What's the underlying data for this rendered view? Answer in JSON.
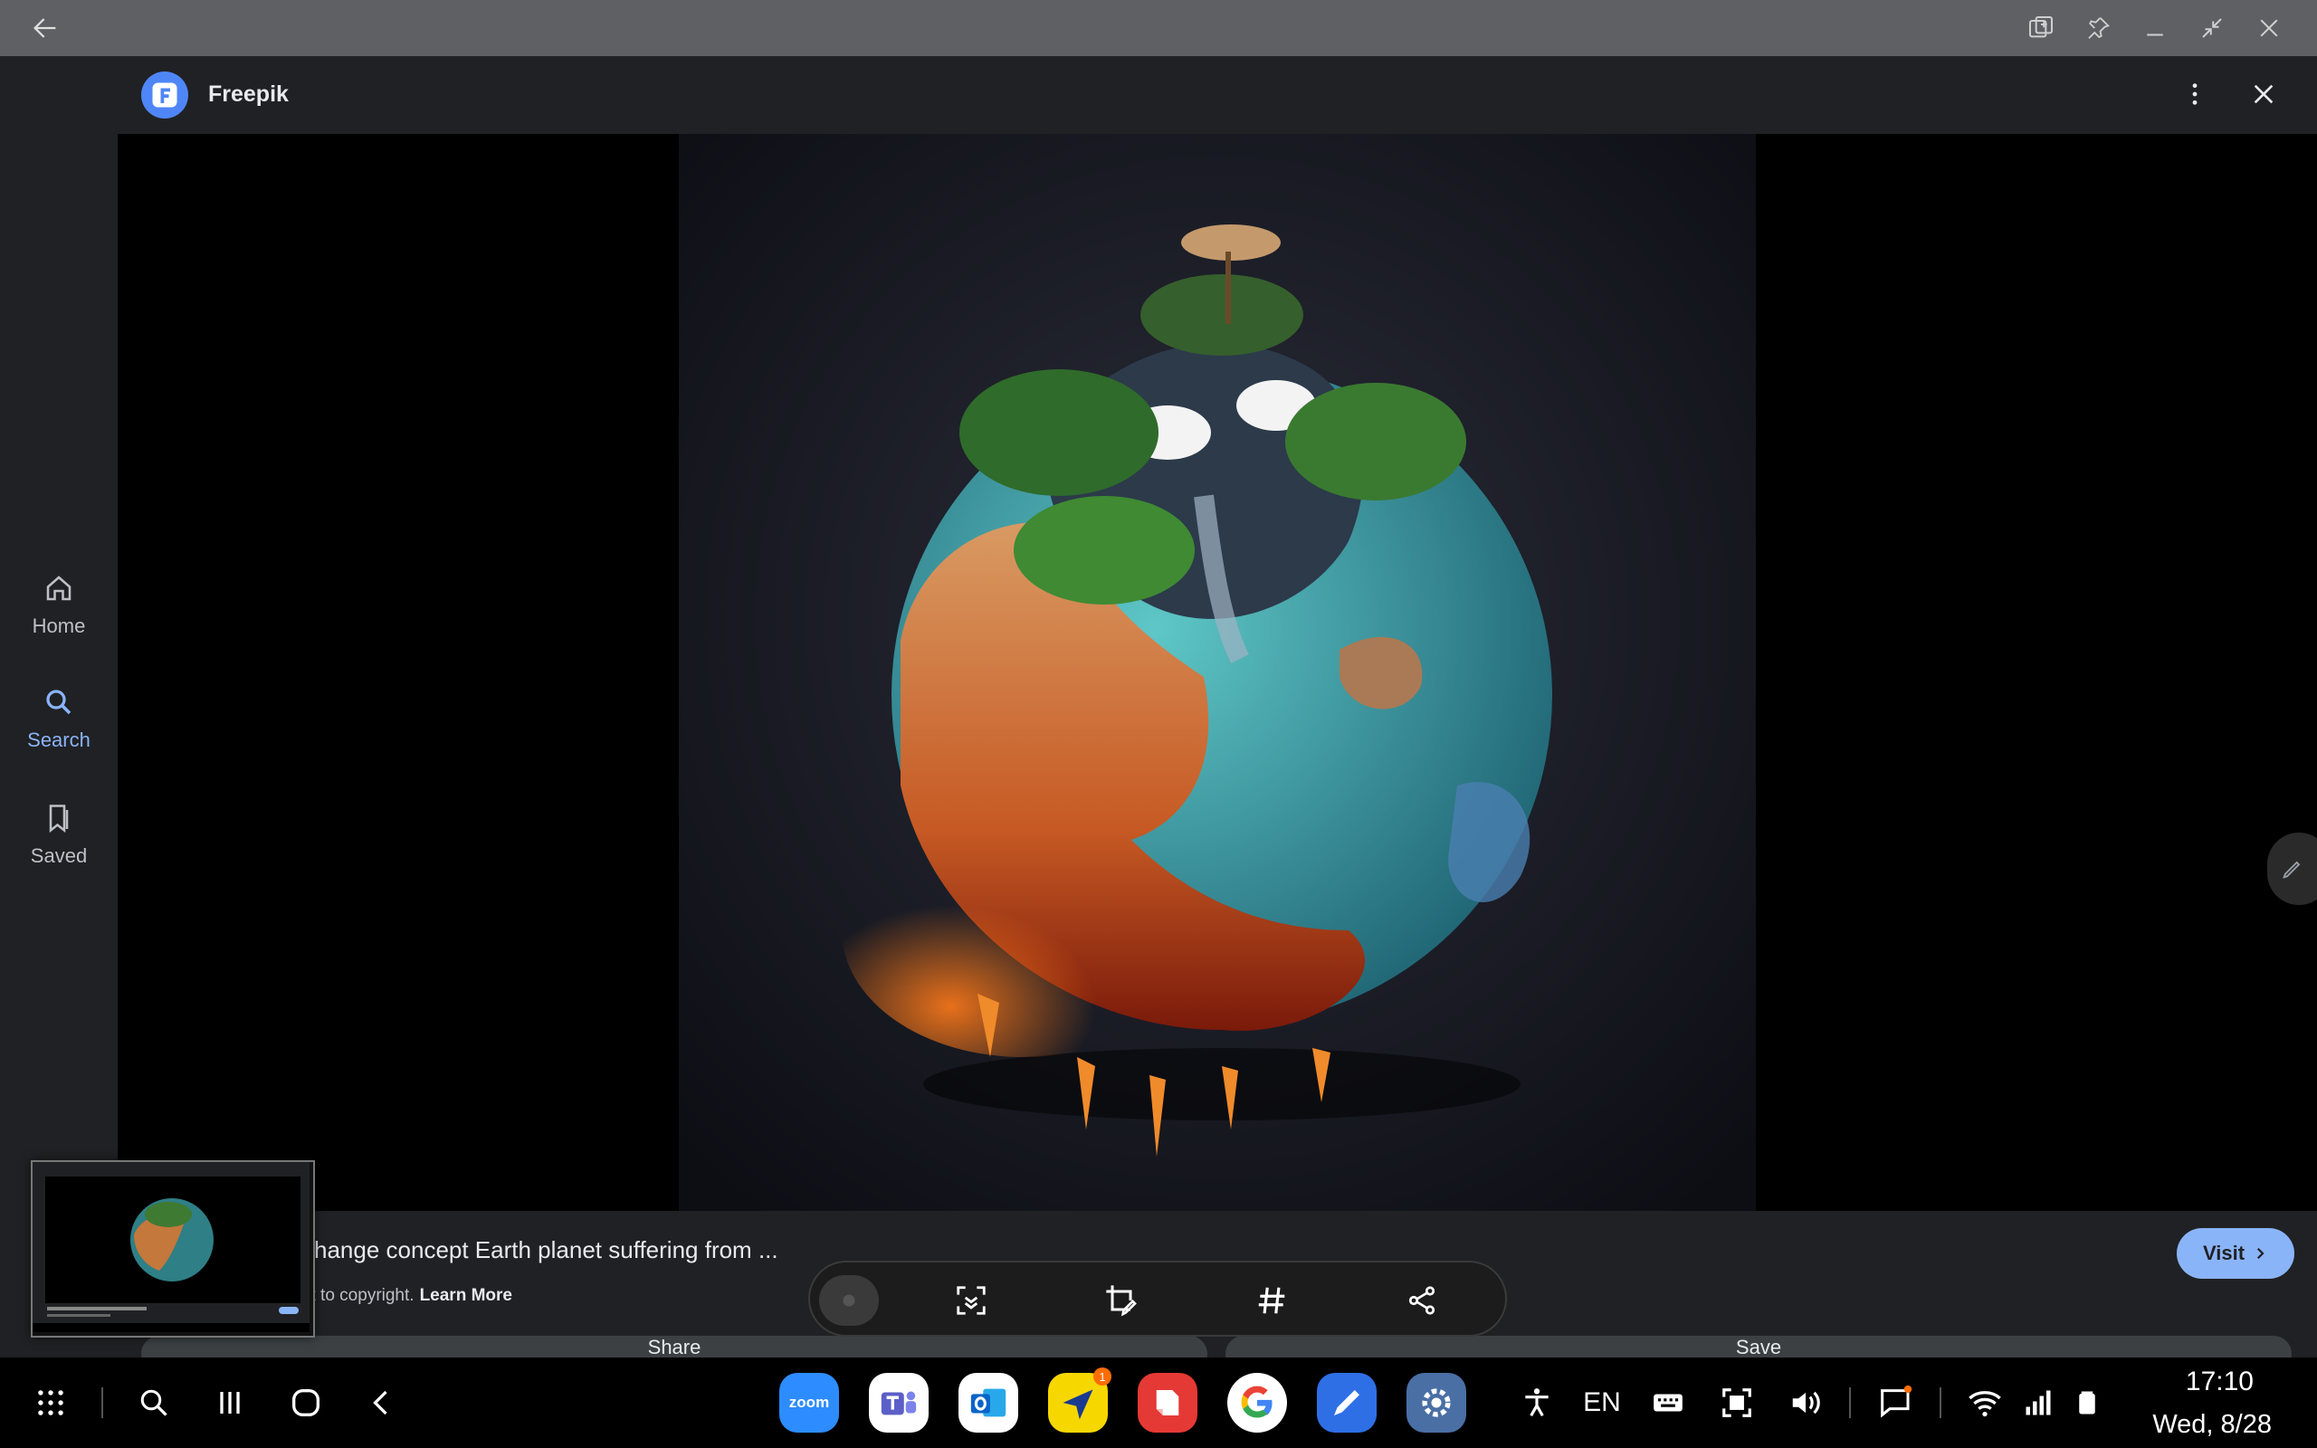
{
  "app": {
    "title": "Freepik"
  },
  "sidebar": {
    "items": [
      {
        "label": "Home",
        "icon": "home-icon"
      },
      {
        "label": "Search",
        "icon": "search-icon",
        "active": true
      },
      {
        "label": "Saved",
        "icon": "bookmark-icon"
      }
    ]
  },
  "result": {
    "caption": "change concept Earth planet suffering from ...",
    "copyright_text": "ct to copyright.",
    "learn_more": "Learn More",
    "visit_label": "Visit",
    "share_label": "Share",
    "save_label": "Save"
  },
  "taskbar": {
    "apps": [
      {
        "name": "Zoom",
        "label": "zoom",
        "color": "#2d8cff"
      },
      {
        "name": "Microsoft Teams",
        "color": "#5b5fc7"
      },
      {
        "name": "Outlook",
        "color": "#0a64c8"
      },
      {
        "name": "Navigator",
        "color": "#f7d700",
        "badge": "1"
      },
      {
        "name": "Flow",
        "color": "#e53935"
      },
      {
        "name": "Google",
        "color": "#ffffff"
      },
      {
        "name": "Pen",
        "color": "#2f6fe6"
      },
      {
        "name": "Settings",
        "color": "#4a6fa5"
      }
    ],
    "language": "EN",
    "time": "17:10",
    "date": "Wed, 8/28"
  },
  "colors": {
    "accent": "#8ab4f8",
    "window_bar": "#5f6063",
    "background": "#202124"
  }
}
